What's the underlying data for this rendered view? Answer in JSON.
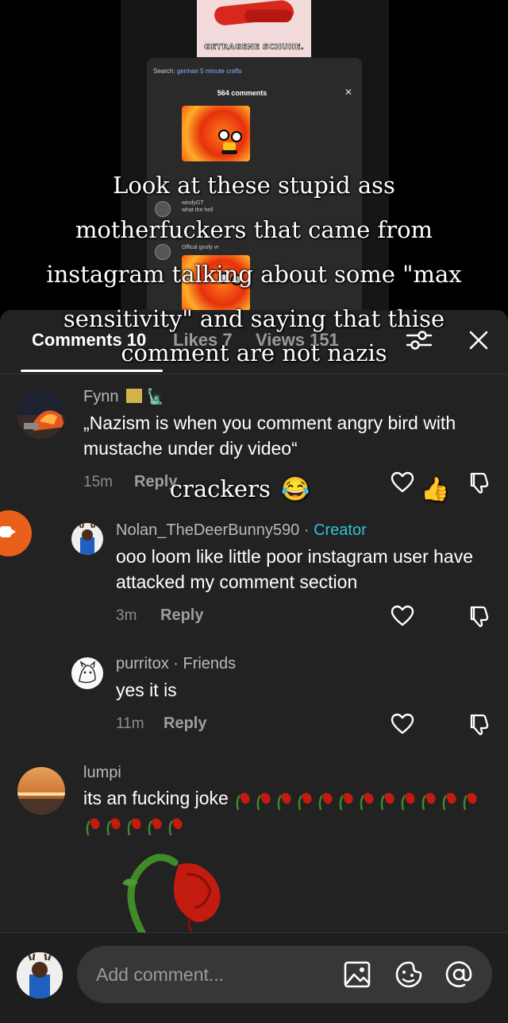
{
  "video": {
    "banner_text": "GETRAGENE SCHUHE.",
    "inner_search_label": "Search:",
    "inner_search_query": "german 5 minute crafts",
    "inner_comment_count": "564 comments",
    "inner_user1": "windyGT",
    "inner_user1_text": "what the hell",
    "inner_user2": "Offical goofy vr",
    "caption_lines": [
      "Look at these stupid ass",
      "motherfuckers that came from",
      "instagram talking about some \"max",
      "sensitivity\" and saying that thise",
      "comment are not nazis"
    ],
    "caption_tail": "crackers"
  },
  "tabs": [
    {
      "label": "Comments 10",
      "active": true
    },
    {
      "label": "Likes 7",
      "active": false
    },
    {
      "label": "Views 151",
      "active": false
    }
  ],
  "comments": [
    {
      "username": "Fynn",
      "text": "„Nazism is when you comment angry bird with mustache under diy video“",
      "time": "15m",
      "reply": "Reply"
    },
    {
      "username": "Nolan_TheDeerBunny590",
      "tag": "Creator",
      "text": "ooo loom like little poor instagram user have attacked my comment section",
      "time": "3m",
      "reply": "Reply"
    },
    {
      "username": "purritox",
      "tag": "Friends",
      "text": "yes it is",
      "time": "11m",
      "reply": "Reply"
    },
    {
      "username": "lumpi",
      "text": "its an fucking joke"
    }
  ],
  "input": {
    "placeholder": "Add comment..."
  },
  "icons": {
    "filter": "filter-sliders-icon",
    "close": "close-icon",
    "heart": "heart-icon",
    "dislike": "dislike-icon",
    "image": "image-icon",
    "emoji": "emoji-icon",
    "mention": "at-mention-icon"
  },
  "colors": {
    "sheet_bg": "#222222",
    "creator_tag": "#2ec4d6",
    "record_button": "#ea5f19"
  }
}
